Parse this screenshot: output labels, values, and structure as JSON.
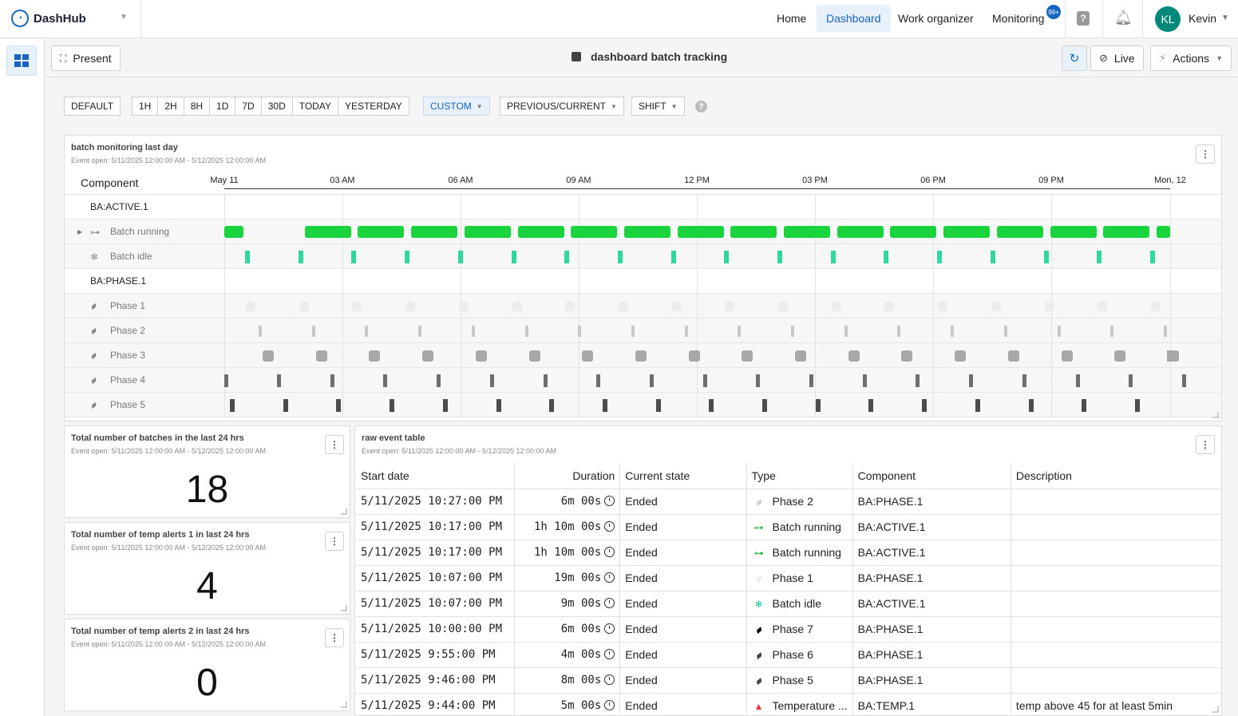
{
  "colors": {
    "accent": "#1565c0",
    "running": "#19d43c",
    "idle": "#2ed8a0",
    "phase1": "#ececec",
    "phase2": "#c8c8c8",
    "phase3": "#a8a8a8",
    "phase4": "#6e6e6e",
    "phase5": "#4c4c4c",
    "alert": "#e53935"
  },
  "app": {
    "name": "DashHub"
  },
  "nav": {
    "home": "Home",
    "dashboard": "Dashboard",
    "work_organizer": "Work organizer",
    "monitoring": "Monitoring",
    "monitoring_badge": "99+"
  },
  "user": {
    "initials": "KL",
    "name": "Kevin"
  },
  "toolbar": {
    "present": "Present",
    "title": "dashboard batch tracking",
    "live": "Live",
    "actions": "Actions"
  },
  "filters": {
    "default": "DEFAULT",
    "ranges": [
      "1H",
      "2H",
      "8H",
      "1D",
      "7D",
      "30D",
      "TODAY",
      "YESTERDAY"
    ],
    "custom": "CUSTOM",
    "compare": "PREVIOUS/CURRENT",
    "shift": "SHIFT",
    "help": "?"
  },
  "timeline": {
    "title": "batch monitoring last day",
    "subtitle": "Event open: 5/11/2025 12:00:00 AM - 5/12/2025 12:00:00 AM",
    "component_header": "Component",
    "ticks": [
      "May 11",
      "03 AM",
      "06 AM",
      "09 AM",
      "12 PM",
      "03 PM",
      "06 PM",
      "09 PM",
      "Mon, 12"
    ],
    "rows": [
      {
        "label": "BA:ACTIVE.1",
        "kind": "group",
        "icon": ""
      },
      {
        "label": "Batch running",
        "kind": "sub",
        "icon": "connector-icon",
        "expandable": true
      },
      {
        "label": "Batch idle",
        "kind": "sub",
        "icon": "snowflake-icon"
      },
      {
        "label": "BA:PHASE.1",
        "kind": "group",
        "icon": ""
      },
      {
        "label": "Phase 1",
        "kind": "sub",
        "icon": "ruler-icon"
      },
      {
        "label": "Phase 2",
        "kind": "sub",
        "icon": "ruler-icon"
      },
      {
        "label": "Phase 3",
        "kind": "sub",
        "icon": "ruler-icon"
      },
      {
        "label": "Phase 4",
        "kind": "sub",
        "icon": "ruler-icon"
      },
      {
        "label": "Phase 5",
        "kind": "sub",
        "icon": "ruler-icon"
      }
    ]
  },
  "kpis": [
    {
      "title": "Total number of batches in the last 24 hrs",
      "subtitle": "Event open: 5/11/2025 12:00:00 AM - 5/12/2025 12:00:00 AM",
      "value": "18"
    },
    {
      "title": "Total number of temp alerts 1 in last 24 hrs",
      "subtitle": "Event open: 5/11/2025 12:00:00 AM - 5/12/2025 12:00:00 AM",
      "value": "4"
    },
    {
      "title": "Total number of temp alerts 2 in last 24 hrs",
      "subtitle": "Event open: 5/11/2025 12:00:00 AM - 5/12/2025 12:00:00 AM",
      "value": "0"
    }
  ],
  "events": {
    "title": "raw event table",
    "subtitle": "Event open: 5/11/2025 12:00:00 AM - 5/12/2025 12:00:00 AM",
    "columns": [
      "Start date",
      "Duration",
      "Current state",
      "Type",
      "Component",
      "Description"
    ],
    "rows": [
      {
        "start": "5/11/2025 10:27:00 PM",
        "duration": "6m 00s",
        "state": "Ended",
        "type": "Phase 2",
        "type_icon": "ruler-icon-light",
        "component": "BA:PHASE.1",
        "description": ""
      },
      {
        "start": "5/11/2025 10:17:00 PM",
        "duration": "1h 10m 00s",
        "state": "Ended",
        "type": "Batch running",
        "type_icon": "connector-icon-green",
        "component": "BA:ACTIVE.1",
        "description": ""
      },
      {
        "start": "5/11/2025 10:17:00 PM",
        "duration": "1h 10m 00s",
        "state": "Ended",
        "type": "Batch running",
        "type_icon": "connector-icon-green",
        "component": "BA:ACTIVE.1",
        "description": ""
      },
      {
        "start": "5/11/2025 10:07:00 PM",
        "duration": "19m 00s",
        "state": "Ended",
        "type": "Phase 1",
        "type_icon": "ruler-icon-faint",
        "component": "BA:PHASE.1",
        "description": ""
      },
      {
        "start": "5/11/2025 10:07:00 PM",
        "duration": "9m 00s",
        "state": "Ended",
        "type": "Batch idle",
        "type_icon": "snowflake-icon-teal",
        "component": "BA:ACTIVE.1",
        "description": ""
      },
      {
        "start": "5/11/2025 10:00:00 PM",
        "duration": "6m 00s",
        "state": "Ended",
        "type": "Phase 7",
        "type_icon": "ruler-icon-black",
        "component": "BA:PHASE.1",
        "description": ""
      },
      {
        "start": "5/11/2025 9:55:00 PM",
        "duration": "4m 00s",
        "state": "Ended",
        "type": "Phase 6",
        "type_icon": "ruler-icon-dark",
        "component": "BA:PHASE.1",
        "description": ""
      },
      {
        "start": "5/11/2025 9:46:00 PM",
        "duration": "8m 00s",
        "state": "Ended",
        "type": "Phase 5",
        "type_icon": "ruler-icon-dark",
        "component": "BA:PHASE.1",
        "description": ""
      },
      {
        "start": "5/11/2025 9:44:00 PM",
        "duration": "5m 00s",
        "state": "Ended",
        "type": "Temperature ...",
        "type_icon": "warning-icon",
        "component": "BA:TEMP.1",
        "description": "temp above 45 for at least 5min"
      }
    ]
  }
}
